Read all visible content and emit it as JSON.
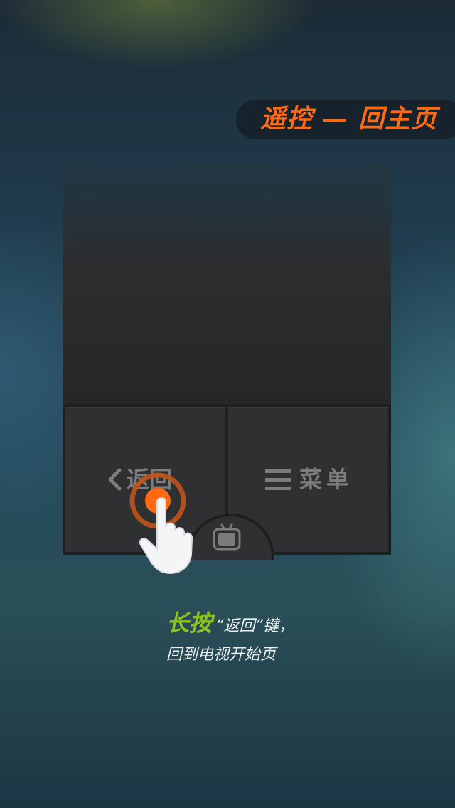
{
  "banner": {
    "title": "遥控 — 回主页"
  },
  "remote": {
    "back_label": "返回",
    "menu_label": "菜单"
  },
  "caption": {
    "strong": "长按",
    "rest": "“返回”键，",
    "line2": "回到电视开始页"
  },
  "colors": {
    "accent": "#ff6a12",
    "highlight": "#8dc21f",
    "button_bg": "#2e3032"
  },
  "icons": [
    "chevron-left-icon",
    "hamburger-icon",
    "tv-icon",
    "hand-pointer-icon"
  ]
}
